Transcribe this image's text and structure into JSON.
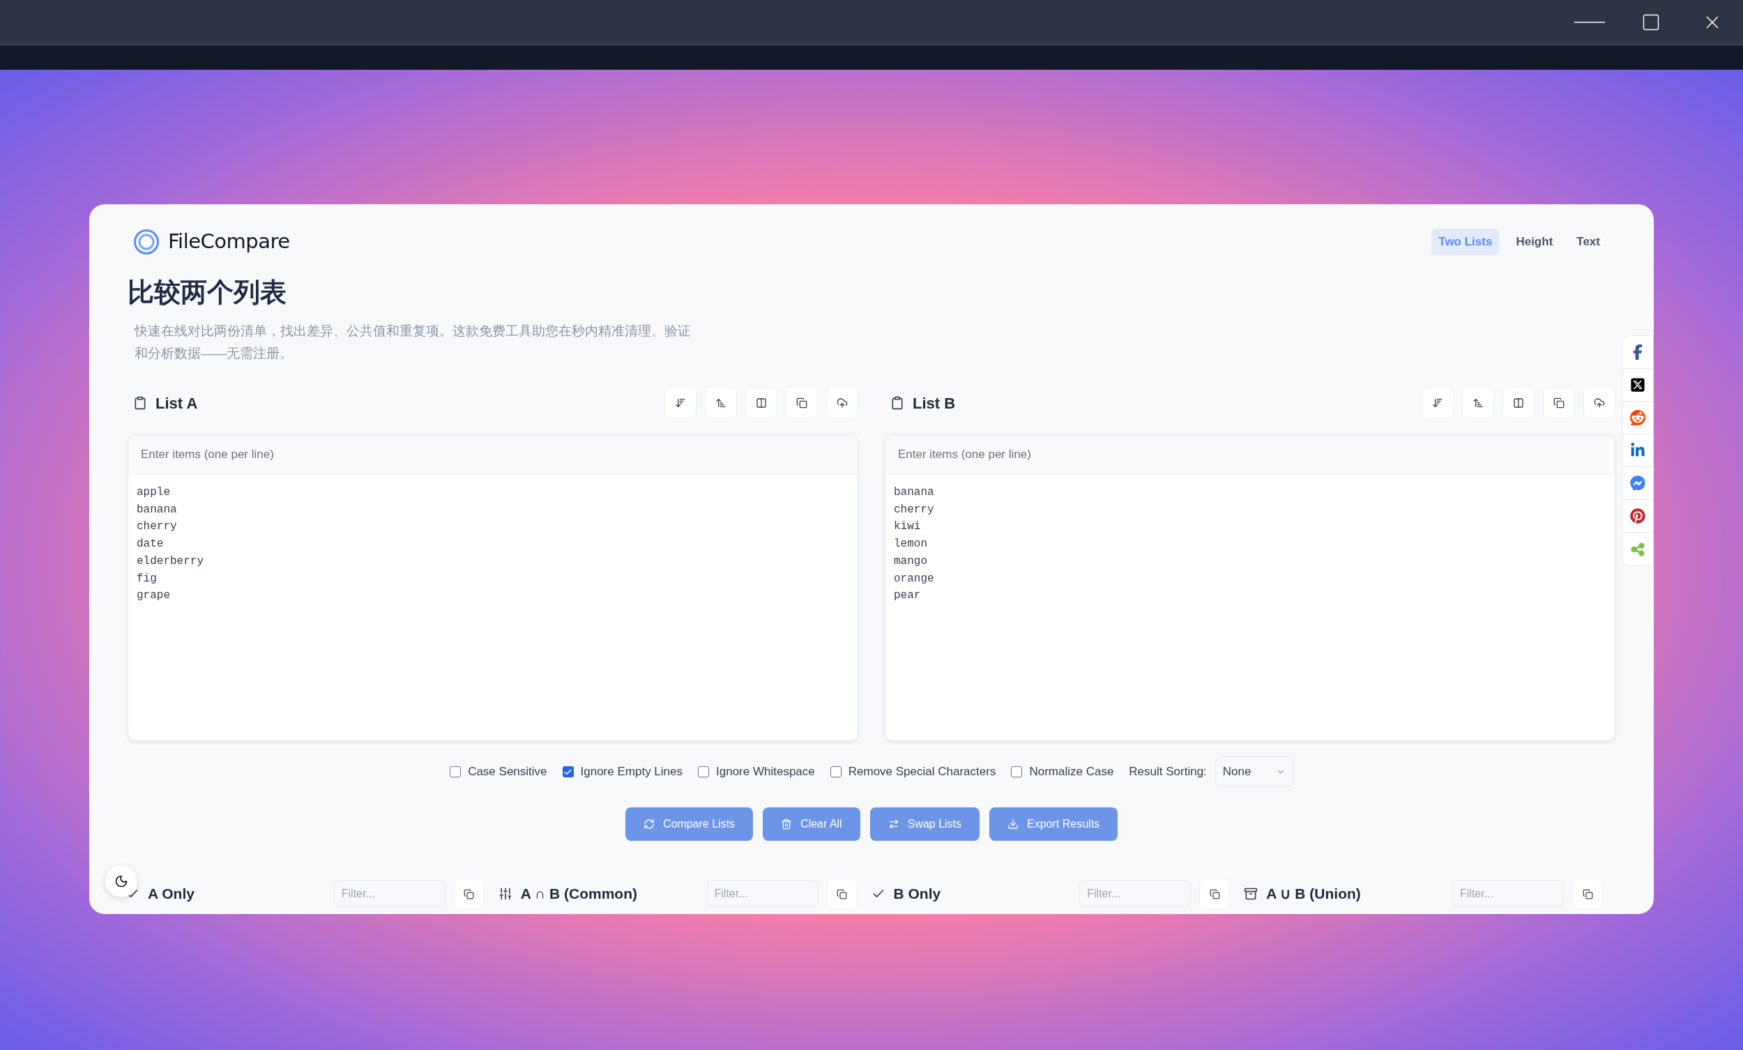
{
  "app": {
    "logo": "FileCompare"
  },
  "nav_tabs": [
    {
      "label": "Two Lists",
      "selected": true
    },
    {
      "label": "Height",
      "selected": false
    },
    {
      "label": "Text",
      "selected": false
    }
  ],
  "heading": "比较两个列表",
  "description": "快速在线对比两份清单，找出差异、公共值和重复项。这款免费工具助您在秒内精准清理、验证和分析数据——无需注册。",
  "lists": [
    {
      "title": "List A",
      "placeholder": "Enter items (one per line)",
      "items": [
        "apple",
        "banana",
        "cherry",
        "date",
        "elderberry",
        "fig",
        "grape"
      ]
    },
    {
      "title": "List B",
      "placeholder": "Enter items (one per line)",
      "items": [
        "banana",
        "cherry",
        "kiwi",
        "lemon",
        "mango",
        "orange",
        "pear"
      ]
    }
  ],
  "options": [
    {
      "label": "Case Sensitive",
      "checked": false
    },
    {
      "label": "Ignore Empty Lines",
      "checked": true
    },
    {
      "label": "Ignore Whitespace",
      "checked": false
    },
    {
      "label": "Remove Special Characters",
      "checked": false
    },
    {
      "label": "Normalize Case",
      "checked": false
    }
  ],
  "sorting": {
    "label": "Result Sorting:",
    "value": "None"
  },
  "actions": [
    {
      "kind": "compare",
      "label": "Compare Lists"
    },
    {
      "kind": "clear",
      "label": "Clear All"
    },
    {
      "kind": "swap",
      "label": "Swap Lists"
    },
    {
      "kind": "export",
      "label": "Export Results"
    }
  ],
  "results": [
    {
      "kind": "a_only",
      "title": "A Only",
      "placeholder": "Filter..."
    },
    {
      "kind": "common",
      "title": "A ∩ B (Common)",
      "placeholder": "Filter..."
    },
    {
      "kind": "b_only",
      "title": "B Only",
      "placeholder": "Filter..."
    },
    {
      "kind": "union",
      "title": "A ∪ B (Union)",
      "placeholder": "Filter..."
    }
  ],
  "share": [
    {
      "kind": "facebook"
    },
    {
      "kind": "x"
    },
    {
      "kind": "reddit"
    },
    {
      "kind": "linkedin"
    },
    {
      "kind": "messenger"
    },
    {
      "kind": "pinterest"
    },
    {
      "kind": "share"
    }
  ]
}
